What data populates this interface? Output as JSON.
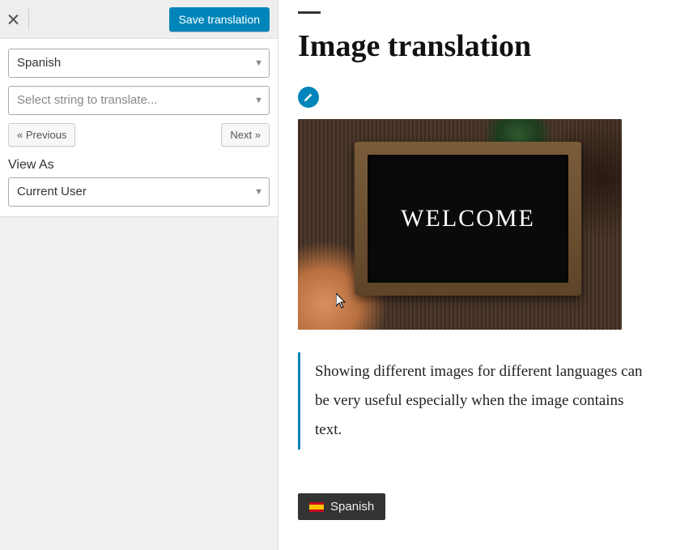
{
  "sidebar": {
    "save_label": "Save translation",
    "language_select": "Spanish",
    "string_select_placeholder": "Select string to translate...",
    "prev_label": "« Previous",
    "next_label": "Next »",
    "view_as_label": "View As",
    "view_as_value": "Current User"
  },
  "preview": {
    "title": "Image translation",
    "chalkboard_text": "WELCOME",
    "quote": "Showing different images for different languages can be very useful especially when the image contains text.",
    "lang_switcher_label": "Spanish"
  }
}
